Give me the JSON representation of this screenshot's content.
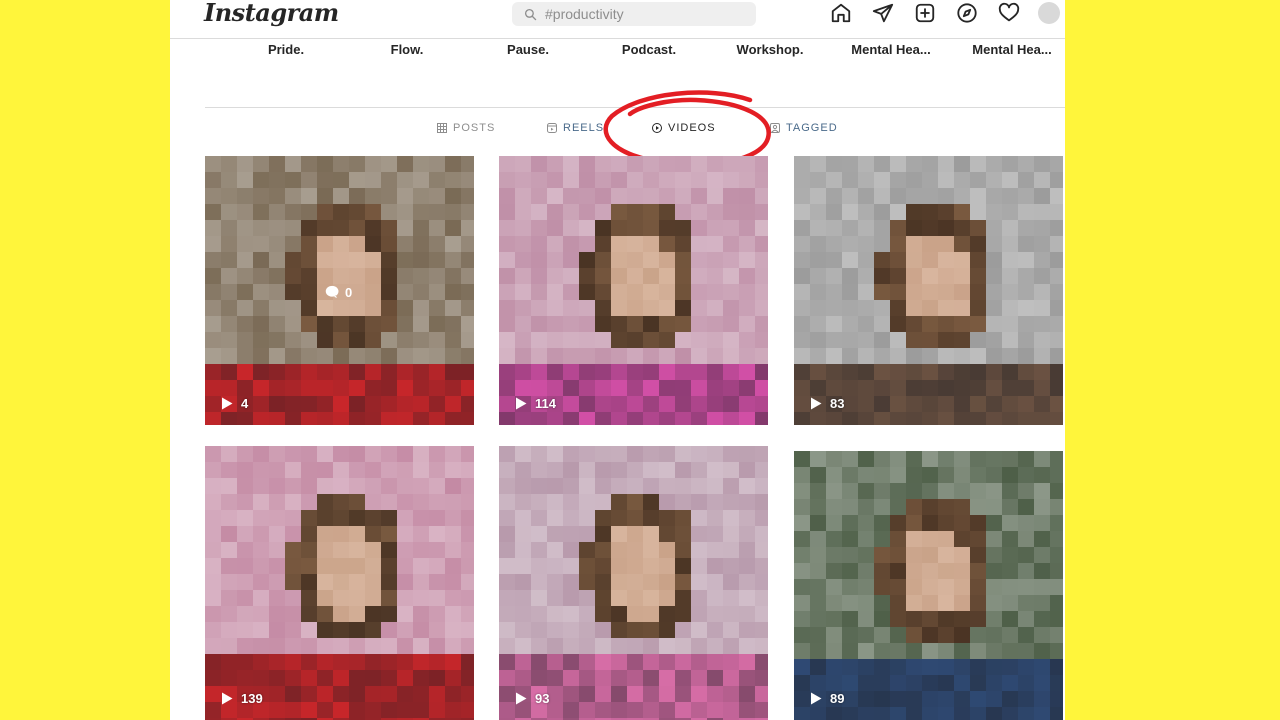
{
  "header": {
    "logo": "Instagram",
    "search_placeholder": "#productivity"
  },
  "nav_icons": [
    "home-icon",
    "send-icon",
    "new-post-icon",
    "explore-icon",
    "heart-icon",
    "avatar"
  ],
  "highlights": [
    {
      "label": "Pride."
    },
    {
      "label": "Flow."
    },
    {
      "label": "Pause."
    },
    {
      "label": "Podcast."
    },
    {
      "label": "Workshop."
    },
    {
      "label": "Mental Hea..."
    },
    {
      "label": "Mental Hea..."
    }
  ],
  "tabs": [
    {
      "label": "POSTS",
      "icon": "grid-icon"
    },
    {
      "label": "REELS",
      "icon": "reels-icon"
    },
    {
      "label": "VIDEOS",
      "icon": "video-icon"
    },
    {
      "label": "TAGGED",
      "icon": "tagged-icon"
    }
  ],
  "active_tab": "VIDEOS",
  "annotation_color": "#E31E24",
  "videos": [
    {
      "views": "4",
      "comments": "0",
      "bg": "#7a6a55",
      "accent": "#c8262a"
    },
    {
      "views": "114",
      "bg": "#c090a8",
      "accent": "#d24fa6"
    },
    {
      "views": "83",
      "bg": "#9c9c9c",
      "accent": "#6b5242"
    },
    {
      "views": "139",
      "bg": "#c48aa4",
      "accent": "#c8262a"
    },
    {
      "views": "93",
      "bg": "#b89aac",
      "accent": "#d96ea8"
    },
    {
      "views": "89",
      "bg": "#4e5f48",
      "accent": "#2f4a74"
    }
  ]
}
